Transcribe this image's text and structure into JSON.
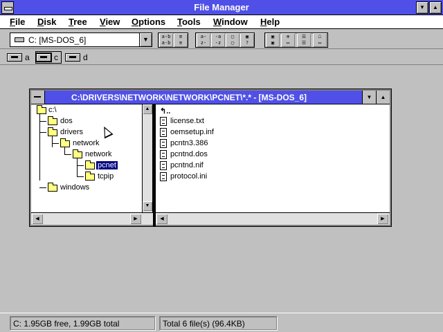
{
  "window": {
    "title": "File Manager"
  },
  "menu": [
    "File",
    "Disk",
    "Tree",
    "View",
    "Options",
    "Tools",
    "Window",
    "Help"
  ],
  "toolbar": {
    "drive_combo_value": "C: [MS-DOS_6]",
    "buttons": [
      {
        "icon": "tree-and-directory-icon"
      },
      {
        "icon": "directory-only-icon"
      },
      {
        "icon": "sort-by-name-icon"
      },
      {
        "icon": "sort-by-type-icon"
      },
      {
        "icon": "sort-by-size-icon"
      },
      {
        "icon": "sort-by-date-icon"
      },
      {
        "icon": "connect-network-drive-icon"
      },
      {
        "icon": "disconnect-network-drive-icon"
      },
      {
        "icon": "share-as-icon"
      },
      {
        "icon": "stop-sharing-icon"
      }
    ]
  },
  "drives": [
    {
      "letter": "a",
      "type": "floppy"
    },
    {
      "letter": "c",
      "type": "hard-disk",
      "selected": true
    },
    {
      "letter": "d",
      "type": "cd-rom"
    }
  ],
  "child_window": {
    "title": "C:\\DRIVERS\\NETWORK\\NETWORK\\PCNET\\*.* - [MS-DOS_6]",
    "tree": [
      {
        "label": "c:\\",
        "depth": 0
      },
      {
        "label": "dos",
        "depth": 1
      },
      {
        "label": "drivers",
        "depth": 1
      },
      {
        "label": "network",
        "depth": 2
      },
      {
        "label": "network",
        "depth": 3
      },
      {
        "label": "pcnet",
        "depth": 4,
        "selected": true
      },
      {
        "label": "tcpip",
        "depth": 4
      },
      {
        "label": "windows",
        "depth": 1
      }
    ],
    "files": {
      "up_label": "..",
      "items": [
        "license.txt",
        "oemsetup.inf",
        "pcntn3.386",
        "pcntnd.dos",
        "pcntnd.nif",
        "protocol.ini"
      ]
    }
  },
  "status": {
    "disk": "C: 1.95GB free,  1.99GB total",
    "files": "Total 6 file(s) (96.4KB)"
  }
}
